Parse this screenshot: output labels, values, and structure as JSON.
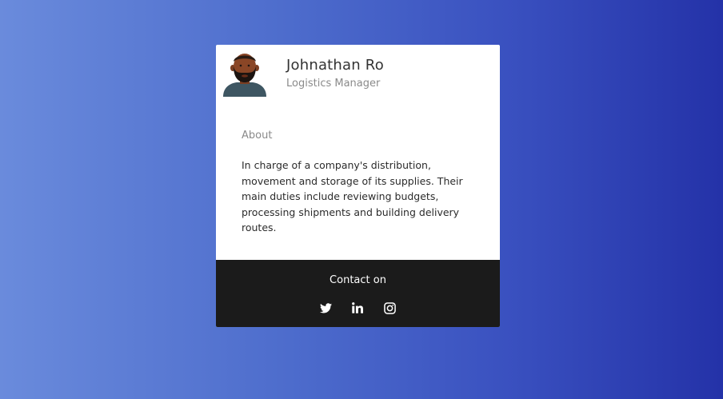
{
  "profile": {
    "name": "Johnathan Ro",
    "role": "Logistics Manager"
  },
  "about": {
    "title": "About",
    "text": "In charge of a company's distribution, movement and storage of its supplies. Their main duties include reviewing budgets, processing shipments and building delivery routes."
  },
  "footer": {
    "contact_label": "Contact on",
    "icons": [
      "twitter-icon",
      "linkedin-icon",
      "instagram-icon"
    ]
  },
  "colors": {
    "background_start": "#6a8bdc",
    "background_end": "#2432a8",
    "card": "#ffffff",
    "footer": "#1b1b1b"
  }
}
